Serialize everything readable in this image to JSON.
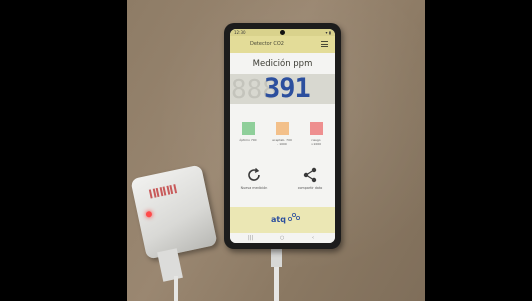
{
  "app": {
    "status_time": "12:30",
    "status_icons": "▾ ▮",
    "title": "Detector CO2",
    "heading": "Medición ppm",
    "reading_ghost": "888",
    "reading": "391",
    "legend": [
      {
        "label": "óptimo 700",
        "color": "#8fcf9a"
      },
      {
        "label": "aceptab. 700 - 1000",
        "color": "#f3c08a"
      },
      {
        "label": "riesgo >1000",
        "color": "#ee8f8f"
      }
    ],
    "actions": {
      "refresh_label": "Nueva medición",
      "share_label": "compartir dato"
    },
    "logo": "atq",
    "nav": {
      "recent": "|||",
      "home": "○",
      "back": "‹"
    }
  },
  "colors": {
    "reading": "#2c4f9e",
    "header": "#e3dc98",
    "led": "#ff4a4a"
  },
  "icons": [
    "menu-icon",
    "refresh-icon",
    "share-icon",
    "logo-icon"
  ]
}
